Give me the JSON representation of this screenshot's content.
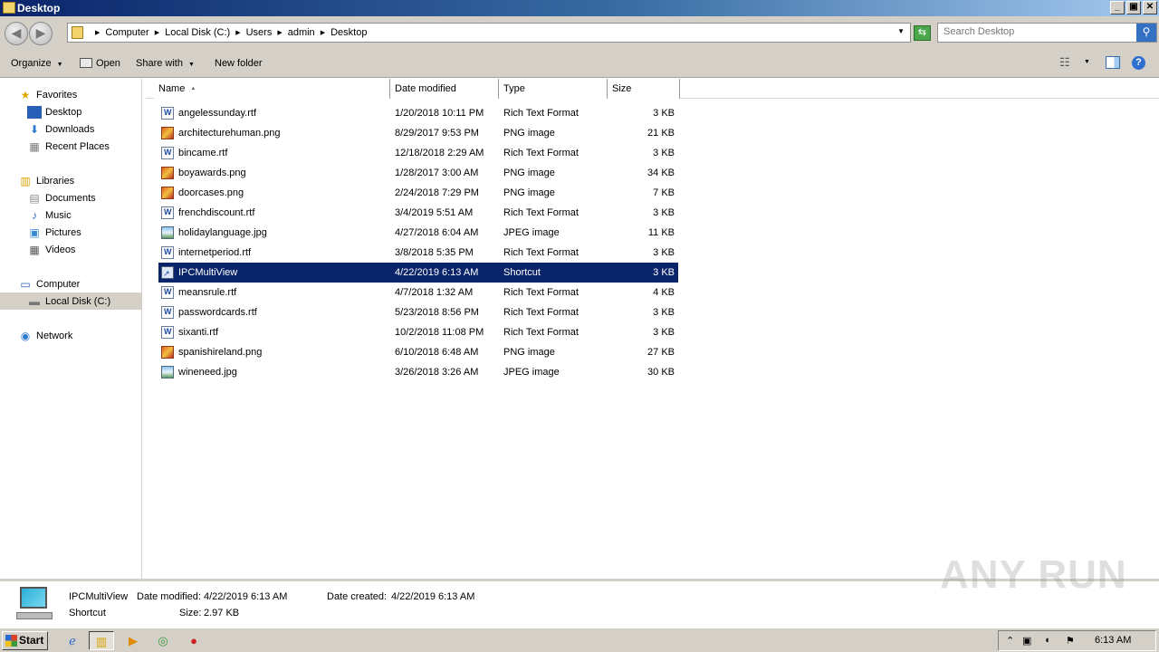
{
  "window": {
    "title": "Desktop",
    "min_label": "_",
    "max_label": "▣",
    "close_label": "✕"
  },
  "address": {
    "crumbs": [
      "Computer",
      "Local Disk (C:)",
      "Users",
      "admin",
      "Desktop"
    ],
    "search_placeholder": "Search Desktop"
  },
  "toolbar": {
    "organize": "Organize",
    "open": "Open",
    "share_with": "Share with",
    "new_folder": "New folder"
  },
  "nav": {
    "favorites": "Favorites",
    "desktop": "Desktop",
    "downloads": "Downloads",
    "recent_places": "Recent Places",
    "libraries": "Libraries",
    "documents": "Documents",
    "music": "Music",
    "pictures": "Pictures",
    "videos": "Videos",
    "computer": "Computer",
    "local_disk": "Local Disk (C:)",
    "network": "Network"
  },
  "columns": {
    "name": "Name",
    "date": "Date modified",
    "type": "Type",
    "size": "Size"
  },
  "files": [
    {
      "name": "angelessunday.rtf",
      "date": "1/20/2018 10:11 PM",
      "type": "Rich Text Format",
      "size": "3 KB",
      "icon": "rtf"
    },
    {
      "name": "architecturehuman.png",
      "date": "8/29/2017 9:53 PM",
      "type": "PNG image",
      "size": "21 KB",
      "icon": "png"
    },
    {
      "name": "bincame.rtf",
      "date": "12/18/2018 2:29 AM",
      "type": "Rich Text Format",
      "size": "3 KB",
      "icon": "rtf"
    },
    {
      "name": "boyawards.png",
      "date": "1/28/2017 3:00 AM",
      "type": "PNG image",
      "size": "34 KB",
      "icon": "png"
    },
    {
      "name": "doorcases.png",
      "date": "2/24/2018 7:29 PM",
      "type": "PNG image",
      "size": "7 KB",
      "icon": "png"
    },
    {
      "name": "frenchdiscount.rtf",
      "date": "3/4/2019 5:51 AM",
      "type": "Rich Text Format",
      "size": "3 KB",
      "icon": "rtf"
    },
    {
      "name": "holidaylanguage.jpg",
      "date": "4/27/2018 6:04 AM",
      "type": "JPEG image",
      "size": "11 KB",
      "icon": "jpg"
    },
    {
      "name": "internetperiod.rtf",
      "date": "3/8/2018 5:35 PM",
      "type": "Rich Text Format",
      "size": "3 KB",
      "icon": "rtf"
    },
    {
      "name": "IPCMultiView",
      "date": "4/22/2019 6:13 AM",
      "type": "Shortcut",
      "size": "3 KB",
      "icon": "lnk",
      "selected": true
    },
    {
      "name": "meansrule.rtf",
      "date": "4/7/2018 1:32 AM",
      "type": "Rich Text Format",
      "size": "4 KB",
      "icon": "rtf"
    },
    {
      "name": "passwordcards.rtf",
      "date": "5/23/2018 8:56 PM",
      "type": "Rich Text Format",
      "size": "3 KB",
      "icon": "rtf"
    },
    {
      "name": "sixanti.rtf",
      "date": "10/2/2018 11:08 PM",
      "type": "Rich Text Format",
      "size": "3 KB",
      "icon": "rtf"
    },
    {
      "name": "spanishireland.png",
      "date": "6/10/2018 6:48 AM",
      "type": "PNG image",
      "size": "27 KB",
      "icon": "png"
    },
    {
      "name": "wineneed.jpg",
      "date": "3/26/2018 3:26 AM",
      "type": "JPEG image",
      "size": "30 KB",
      "icon": "jpg"
    }
  ],
  "details": {
    "name": "IPCMultiView",
    "kind": "Shortcut",
    "date_modified_label": "Date modified:",
    "date_modified": "4/22/2019 6:13 AM",
    "date_created_label": "Date created:",
    "date_created": "4/22/2019 6:13 AM",
    "size_label": "Size:",
    "size": "2.97 KB"
  },
  "watermark": "ANY RUN",
  "taskbar": {
    "start": "Start",
    "clock": "6:13 AM"
  }
}
